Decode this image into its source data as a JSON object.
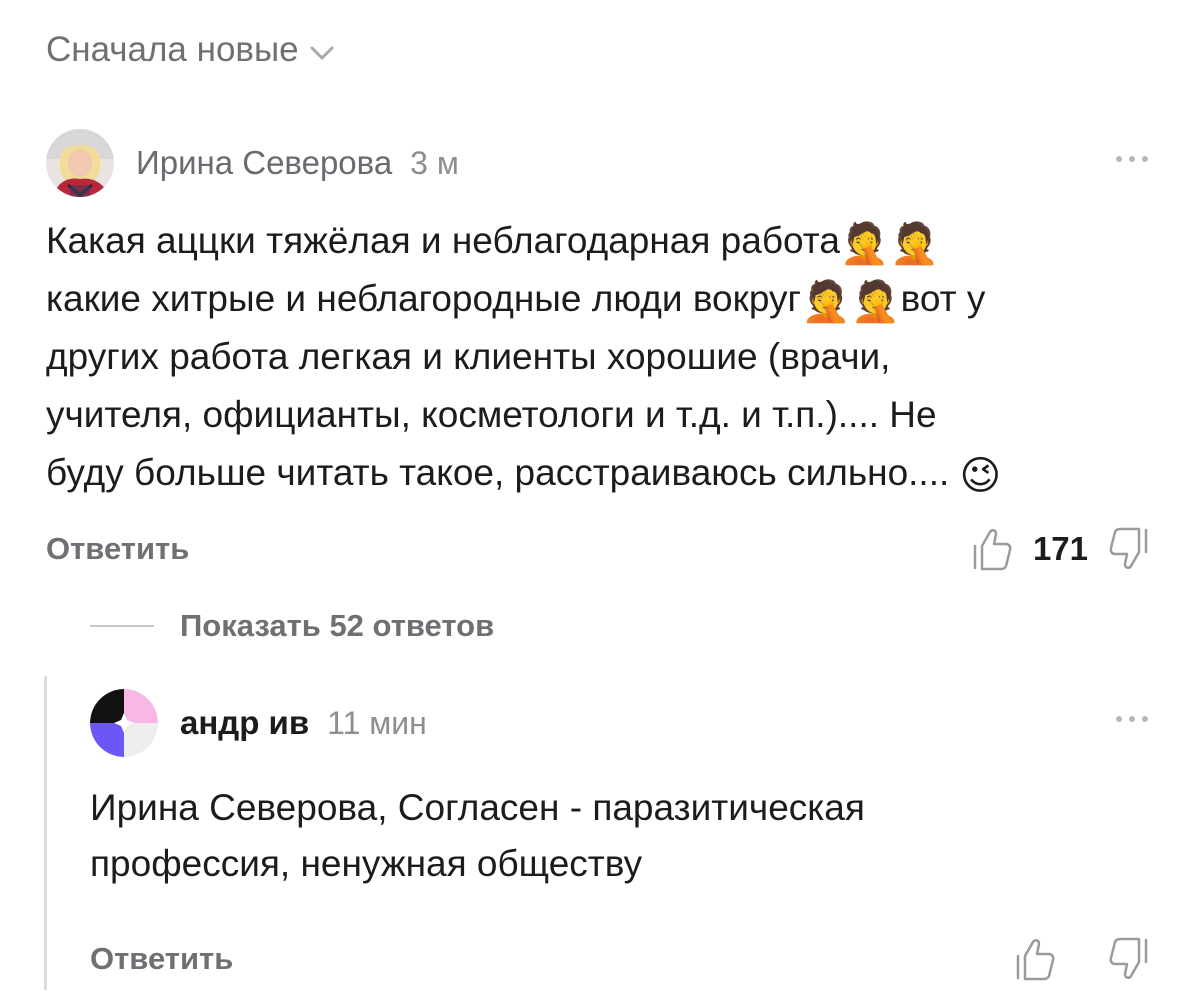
{
  "sort": {
    "label": "Сначала новые"
  },
  "comments": [
    {
      "author": "Ирина Северова",
      "time": "3 м",
      "text_parts": [
        "Какая аццки тяжёлая и неблагодарная работа",
        "🤦🤦",
        "\nкакие хитрые и неблагородные люди вокруг",
        "🤦🤦",
        "вот у\nдругих работа легкая и клиенты хорошие (врачи,\nучителя, официанты, косметологи и т.д. и т.п.).... Не\nбуду больше читать такое, расстраиваюсь сильно.... ",
        "😉"
      ],
      "reply_label": "Ответить",
      "likes": "171"
    },
    {
      "author": "андр ив",
      "time": "11 мин",
      "text": "Ирина Северова, Согласен - паразитическая\nпрофессия, ненужная обществу",
      "reply_label": "Ответить"
    }
  ],
  "show_replies": {
    "label": "Показать 52 ответов"
  },
  "colors": {
    "secondary_text": "#6f6f74",
    "primary_text": "#1c1c1e",
    "thread_line": "#dcdce0"
  },
  "icons": [
    "chevron-down-icon",
    "more-icon",
    "thumbs-up-icon",
    "thumbs-down-icon"
  ]
}
